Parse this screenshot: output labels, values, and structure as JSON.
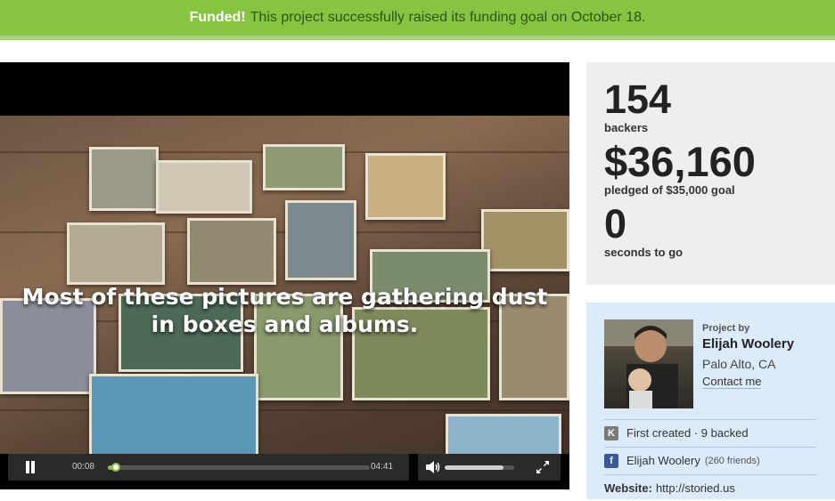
{
  "banner": {
    "status": "Funded!",
    "message": "This project successfully raised its funding goal on October 18."
  },
  "video": {
    "caption_line1": "Most of these pictures are gathering dust",
    "caption_line2": "in boxes and albums.",
    "elapsed": "00:08",
    "duration": "04:41",
    "progress": 0.03,
    "volume": 0.85
  },
  "stats": {
    "backers_count": "154",
    "backers_label": "backers",
    "pledged_amount": "$36,160",
    "pledged_label": "pledged of $35,000 goal",
    "time_left": "0",
    "time_label": "seconds to go"
  },
  "creator": {
    "project_by_label": "Project by",
    "name": "Elijah Woolery",
    "location": "Palo Alto, CA",
    "contact_label": "Contact me",
    "history": "First created · 9 backed",
    "facebook_name": "Elijah Woolery",
    "facebook_friends": "(260 friends)",
    "website_label": "Website:",
    "website_url": "http://storied.us"
  },
  "colors": {
    "banner": "#87c442",
    "stats_bg": "#eeeeee",
    "creator_bg": "#dcebfa"
  }
}
